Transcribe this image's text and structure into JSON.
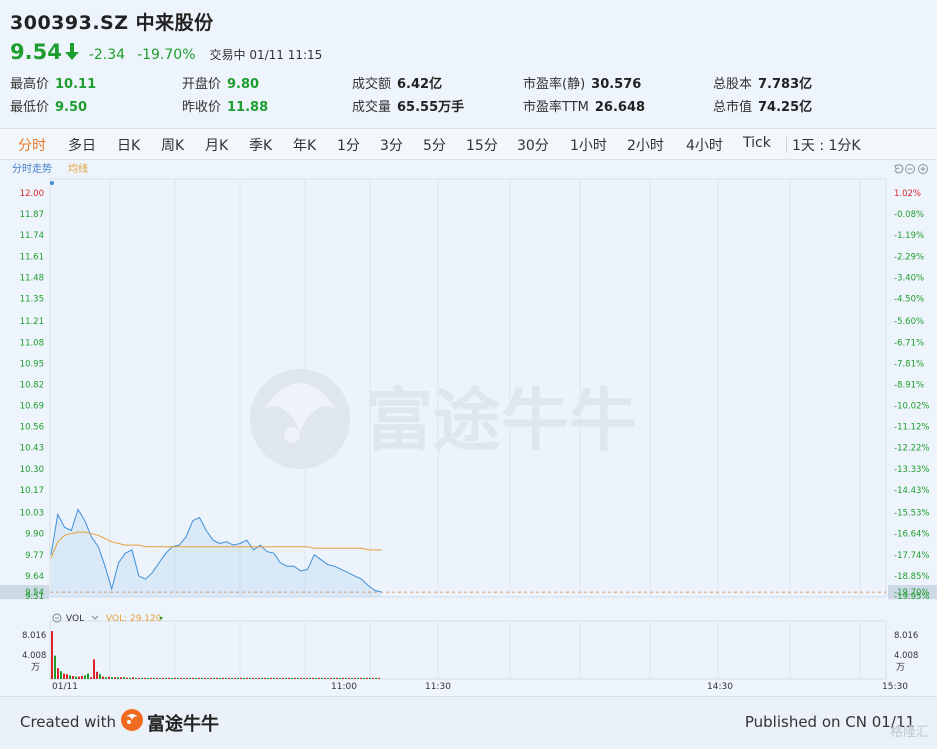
{
  "quote": {
    "title": "300393.SZ 中来股份",
    "price": "9.54",
    "change": "-2.34",
    "change_pct": "-19.70%",
    "status": "交易中 01/11 11:15"
  },
  "stats": [
    {
      "label": "最高价",
      "value": "10.11"
    },
    {
      "label": "开盘价",
      "value": "9.80"
    },
    {
      "label": "成交额",
      "value": "6.42亿"
    },
    {
      "label": "市盈率(静)",
      "value": "30.576"
    },
    {
      "label": "总股本",
      "value": "7.783亿"
    },
    {
      "label": "最低价",
      "value": "9.50"
    },
    {
      "label": "昨收价",
      "value": "11.88"
    },
    {
      "label": "成交量",
      "value": "65.55万手"
    },
    {
      "label": "市盈率TTM",
      "value": "26.648"
    },
    {
      "label": "总市值",
      "value": "74.25亿"
    }
  ],
  "tabs": [
    "分时",
    "多日",
    "日K",
    "周K",
    "月K",
    "季K",
    "年K",
    "1分",
    "3分",
    "5分",
    "15分",
    "30分",
    "1小时",
    "2小时",
    "4小时",
    "Tick",
    "1天 : 1分K"
  ],
  "chart_labels": {
    "time_share": "分时走势",
    "avg_line": "均线",
    "vol": "VOL",
    "vol_value": "VOL: 29.120",
    "vol_unit": "万",
    "watermark": "富途牛牛"
  },
  "colors": {
    "up": "#d9262d",
    "down": "#1e9e2e",
    "price_line": "#3f8fd6",
    "avg_line": "#e3a13a",
    "accent": "#e8782a"
  },
  "chart_data": {
    "type": "line",
    "y_ticks_left": [
      "12.00",
      "11.87",
      "11.74",
      "11.61",
      "11.48",
      "11.35",
      "11.21",
      "11.08",
      "10.95",
      "10.82",
      "10.69",
      "10.56",
      "10.43",
      "10.30",
      "10.17",
      "10.03",
      "9.90",
      "9.77",
      "9.64",
      "9.54",
      "9.51"
    ],
    "y_ticks_right": [
      "1.02%",
      "-0.08%",
      "-1.19%",
      "-2.29%",
      "-3.40%",
      "-4.50%",
      "-5.60%",
      "-6.71%",
      "-7.81%",
      "-8.91%",
      "-10.02%",
      "-11.12%",
      "-12.22%",
      "-13.33%",
      "-14.43%",
      "-15.53%",
      "-16.64%",
      "-17.74%",
      "-18.85%",
      "-19.70%",
      "-19.95%"
    ],
    "x_ticks": [
      "01/11",
      "11:00",
      "11:30",
      "14:30",
      "15:30"
    ],
    "ylim": [
      9.51,
      12.0
    ],
    "prev_close": 11.88,
    "last": 9.54,
    "vol_ticks": [
      "8.016",
      "4.008"
    ],
    "price": [
      9.77,
      10.02,
      9.94,
      9.92,
      10.05,
      9.98,
      9.88,
      9.82,
      9.7,
      9.56,
      9.72,
      9.78,
      9.8,
      9.64,
      9.62,
      9.66,
      9.72,
      9.78,
      9.82,
      9.83,
      9.88,
      9.98,
      10.0,
      9.92,
      9.86,
      9.84,
      9.85,
      9.83,
      9.84,
      9.86,
      9.8,
      9.83,
      9.79,
      9.78,
      9.72,
      9.7,
      9.7,
      9.67,
      9.68,
      9.77,
      9.74,
      9.71,
      9.7,
      9.68,
      9.66,
      9.64,
      9.62,
      9.58,
      9.55,
      9.54
    ],
    "avg": [
      9.75,
      9.85,
      9.89,
      9.9,
      9.91,
      9.91,
      9.9,
      9.89,
      9.87,
      9.85,
      9.84,
      9.83,
      9.83,
      9.83,
      9.82,
      9.82,
      9.82,
      9.82,
      9.82,
      9.82,
      9.82,
      9.82,
      9.82,
      9.82,
      9.82,
      9.82,
      9.82,
      9.82,
      9.82,
      9.82,
      9.82,
      9.82,
      9.82,
      9.82,
      9.82,
      9.82,
      9.82,
      9.82,
      9.82,
      9.81,
      9.81,
      9.81,
      9.81,
      9.81,
      9.81,
      9.81,
      9.81,
      9.8,
      9.8,
      9.8
    ],
    "volume": [
      8.0,
      3.9,
      1.8,
      1.3,
      0.9,
      0.8,
      0.6,
      0.5,
      0.4,
      0.4,
      0.5,
      0.6,
      0.9,
      0.3,
      3.3,
      1.2,
      0.8,
      0.4,
      0.3,
      0.4,
      0.3,
      0.3,
      0.3,
      0.3,
      0.3,
      0.2,
      0.2,
      0.3,
      0.2,
      0.2,
      0.2,
      0.2,
      0.2,
      0.2,
      0.2,
      0.2,
      0.2,
      0.2,
      0.2,
      0.2,
      0.2,
      0.2,
      0.2,
      0.2,
      0.2,
      0.2,
      0.2,
      0.2,
      0.2,
      0.2,
      0.2,
      0.2,
      0.2,
      0.2,
      0.2,
      0.2,
      0.2,
      0.2,
      0.2,
      0.2,
      0.2,
      0.2,
      0.2,
      0.2,
      0.2,
      0.2,
      0.2,
      0.2,
      0.2,
      0.2,
      0.2,
      0.2,
      0.2,
      0.2,
      0.2,
      0.2,
      0.2,
      0.2,
      0.2,
      0.2,
      0.2,
      0.2,
      0.2,
      0.2,
      0.2,
      0.2,
      0.2,
      0.2,
      0.2,
      0.2,
      0.2,
      0.2,
      0.2,
      0.2,
      0.2,
      0.2,
      0.2,
      0.2,
      0.2,
      0.2,
      0.2,
      0.2,
      0.2,
      0.2,
      0.2,
      0.2,
      0.2,
      0.2,
      0.2,
      0.2
    ],
    "volume_up": [
      true,
      false,
      true,
      false,
      true,
      true,
      false,
      true,
      false,
      true,
      true,
      false,
      false,
      true,
      true,
      true,
      false,
      true,
      false,
      true,
      false,
      true,
      false,
      true,
      false,
      true,
      false,
      true,
      false,
      true,
      false,
      true,
      false,
      true,
      false,
      true,
      false,
      true,
      false,
      true,
      false,
      true,
      false,
      true,
      false,
      true,
      false,
      true,
      false,
      true,
      false,
      true,
      false,
      true,
      false,
      true,
      false,
      true,
      false,
      true,
      false,
      true,
      false,
      true,
      false,
      true,
      false,
      true,
      false,
      true,
      false,
      true,
      false,
      true,
      false,
      true,
      false,
      true,
      false,
      true,
      false,
      true,
      false,
      true,
      false,
      true,
      false,
      true,
      false,
      true,
      false,
      true,
      false,
      true,
      false,
      true,
      false,
      true,
      false,
      true,
      false,
      true,
      false,
      true,
      false,
      true,
      false,
      true,
      false,
      true,
      false,
      true
    ]
  },
  "footer": {
    "created_with": "Created with",
    "brand": "富途牛牛",
    "published": "Published on CN 01/11",
    "watermark": "格隆汇"
  }
}
